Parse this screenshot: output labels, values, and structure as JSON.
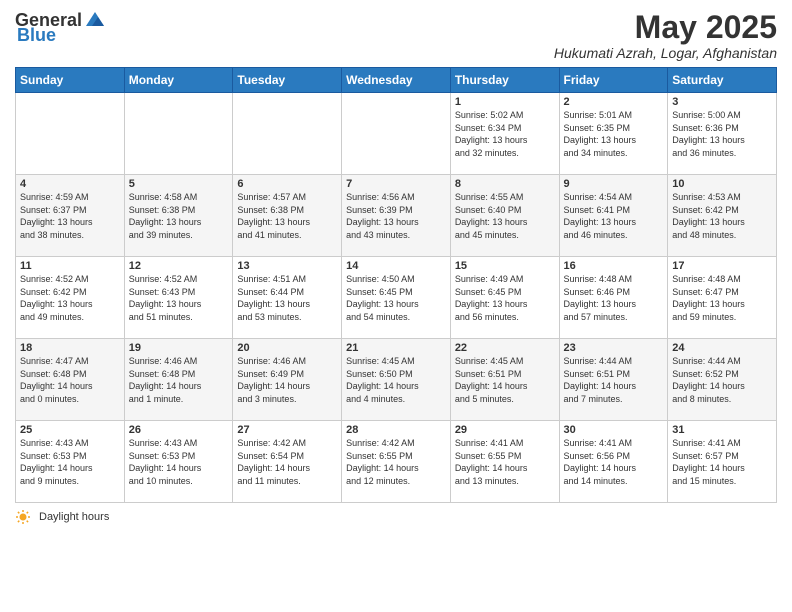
{
  "header": {
    "logo_general": "General",
    "logo_blue": "Blue",
    "title": "May 2025",
    "subtitle": "Hukumati Azrah, Logar, Afghanistan"
  },
  "days_of_week": [
    "Sunday",
    "Monday",
    "Tuesday",
    "Wednesday",
    "Thursday",
    "Friday",
    "Saturday"
  ],
  "weeks": [
    [
      {
        "day": "",
        "info": ""
      },
      {
        "day": "",
        "info": ""
      },
      {
        "day": "",
        "info": ""
      },
      {
        "day": "",
        "info": ""
      },
      {
        "day": "1",
        "info": "Sunrise: 5:02 AM\nSunset: 6:34 PM\nDaylight: 13 hours\nand 32 minutes."
      },
      {
        "day": "2",
        "info": "Sunrise: 5:01 AM\nSunset: 6:35 PM\nDaylight: 13 hours\nand 34 minutes."
      },
      {
        "day": "3",
        "info": "Sunrise: 5:00 AM\nSunset: 6:36 PM\nDaylight: 13 hours\nand 36 minutes."
      }
    ],
    [
      {
        "day": "4",
        "info": "Sunrise: 4:59 AM\nSunset: 6:37 PM\nDaylight: 13 hours\nand 38 minutes."
      },
      {
        "day": "5",
        "info": "Sunrise: 4:58 AM\nSunset: 6:38 PM\nDaylight: 13 hours\nand 39 minutes."
      },
      {
        "day": "6",
        "info": "Sunrise: 4:57 AM\nSunset: 6:38 PM\nDaylight: 13 hours\nand 41 minutes."
      },
      {
        "day": "7",
        "info": "Sunrise: 4:56 AM\nSunset: 6:39 PM\nDaylight: 13 hours\nand 43 minutes."
      },
      {
        "day": "8",
        "info": "Sunrise: 4:55 AM\nSunset: 6:40 PM\nDaylight: 13 hours\nand 45 minutes."
      },
      {
        "day": "9",
        "info": "Sunrise: 4:54 AM\nSunset: 6:41 PM\nDaylight: 13 hours\nand 46 minutes."
      },
      {
        "day": "10",
        "info": "Sunrise: 4:53 AM\nSunset: 6:42 PM\nDaylight: 13 hours\nand 48 minutes."
      }
    ],
    [
      {
        "day": "11",
        "info": "Sunrise: 4:52 AM\nSunset: 6:42 PM\nDaylight: 13 hours\nand 49 minutes."
      },
      {
        "day": "12",
        "info": "Sunrise: 4:52 AM\nSunset: 6:43 PM\nDaylight: 13 hours\nand 51 minutes."
      },
      {
        "day": "13",
        "info": "Sunrise: 4:51 AM\nSunset: 6:44 PM\nDaylight: 13 hours\nand 53 minutes."
      },
      {
        "day": "14",
        "info": "Sunrise: 4:50 AM\nSunset: 6:45 PM\nDaylight: 13 hours\nand 54 minutes."
      },
      {
        "day": "15",
        "info": "Sunrise: 4:49 AM\nSunset: 6:45 PM\nDaylight: 13 hours\nand 56 minutes."
      },
      {
        "day": "16",
        "info": "Sunrise: 4:48 AM\nSunset: 6:46 PM\nDaylight: 13 hours\nand 57 minutes."
      },
      {
        "day": "17",
        "info": "Sunrise: 4:48 AM\nSunset: 6:47 PM\nDaylight: 13 hours\nand 59 minutes."
      }
    ],
    [
      {
        "day": "18",
        "info": "Sunrise: 4:47 AM\nSunset: 6:48 PM\nDaylight: 14 hours\nand 0 minutes."
      },
      {
        "day": "19",
        "info": "Sunrise: 4:46 AM\nSunset: 6:48 PM\nDaylight: 14 hours\nand 1 minute."
      },
      {
        "day": "20",
        "info": "Sunrise: 4:46 AM\nSunset: 6:49 PM\nDaylight: 14 hours\nand 3 minutes."
      },
      {
        "day": "21",
        "info": "Sunrise: 4:45 AM\nSunset: 6:50 PM\nDaylight: 14 hours\nand 4 minutes."
      },
      {
        "day": "22",
        "info": "Sunrise: 4:45 AM\nSunset: 6:51 PM\nDaylight: 14 hours\nand 5 minutes."
      },
      {
        "day": "23",
        "info": "Sunrise: 4:44 AM\nSunset: 6:51 PM\nDaylight: 14 hours\nand 7 minutes."
      },
      {
        "day": "24",
        "info": "Sunrise: 4:44 AM\nSunset: 6:52 PM\nDaylight: 14 hours\nand 8 minutes."
      }
    ],
    [
      {
        "day": "25",
        "info": "Sunrise: 4:43 AM\nSunset: 6:53 PM\nDaylight: 14 hours\nand 9 minutes."
      },
      {
        "day": "26",
        "info": "Sunrise: 4:43 AM\nSunset: 6:53 PM\nDaylight: 14 hours\nand 10 minutes."
      },
      {
        "day": "27",
        "info": "Sunrise: 4:42 AM\nSunset: 6:54 PM\nDaylight: 14 hours\nand 11 minutes."
      },
      {
        "day": "28",
        "info": "Sunrise: 4:42 AM\nSunset: 6:55 PM\nDaylight: 14 hours\nand 12 minutes."
      },
      {
        "day": "29",
        "info": "Sunrise: 4:41 AM\nSunset: 6:55 PM\nDaylight: 14 hours\nand 13 minutes."
      },
      {
        "day": "30",
        "info": "Sunrise: 4:41 AM\nSunset: 6:56 PM\nDaylight: 14 hours\nand 14 minutes."
      },
      {
        "day": "31",
        "info": "Sunrise: 4:41 AM\nSunset: 6:57 PM\nDaylight: 14 hours\nand 15 minutes."
      }
    ]
  ],
  "footer": {
    "label": "Daylight hours"
  }
}
